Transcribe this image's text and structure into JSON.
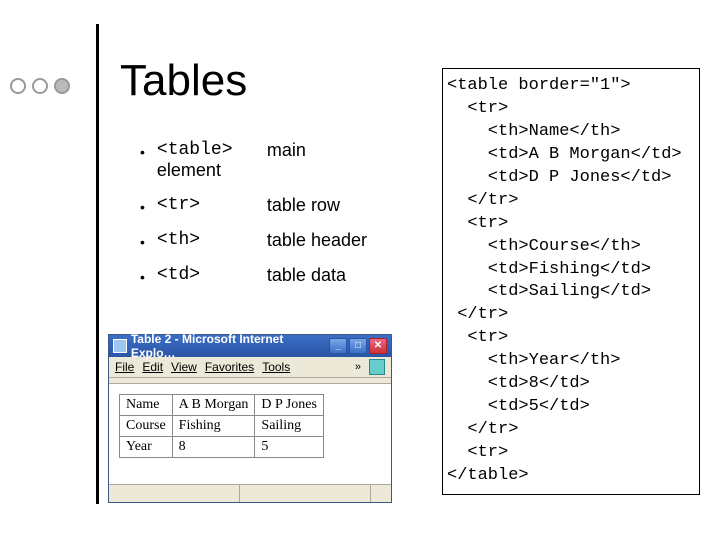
{
  "title": "Tables",
  "bullets": [
    {
      "tag": "<table>",
      "sub": "element",
      "desc": "main"
    },
    {
      "tag": "<tr>",
      "sub": "",
      "desc": "table row"
    },
    {
      "tag": "<th>",
      "sub": "",
      "desc": "table header"
    },
    {
      "tag": "<td>",
      "sub": "",
      "desc": "table data"
    }
  ],
  "code": "<table border=\"1\">\n  <tr>\n    <th>Name</th>\n    <td>A B Morgan</td>\n    <td>D P Jones</td>\n  </tr>\n  <tr>\n    <th>Course</th>\n    <td>Fishing</td>\n    <td>Sailing</td>\n </tr>\n  <tr>\n    <th>Year</th>\n    <td>8</td>\n    <td>5</td>\n  </tr>\n  <tr>\n</table>",
  "browser": {
    "title": "Table 2 - Microsoft Internet Explo…",
    "menus": {
      "file": "File",
      "edit": "Edit",
      "view": "View",
      "favorites": "Favorites",
      "tools": "Tools",
      "more": "»"
    },
    "min": "_",
    "max": "□",
    "close": "✕",
    "table": {
      "rows": [
        {
          "h": "Name",
          "c1": "A B Morgan",
          "c2": "D P Jones"
        },
        {
          "h": "Course",
          "c1": "Fishing",
          "c2": "Sailing"
        },
        {
          "h": "Year",
          "c1": "8",
          "c2": "5"
        }
      ]
    }
  }
}
